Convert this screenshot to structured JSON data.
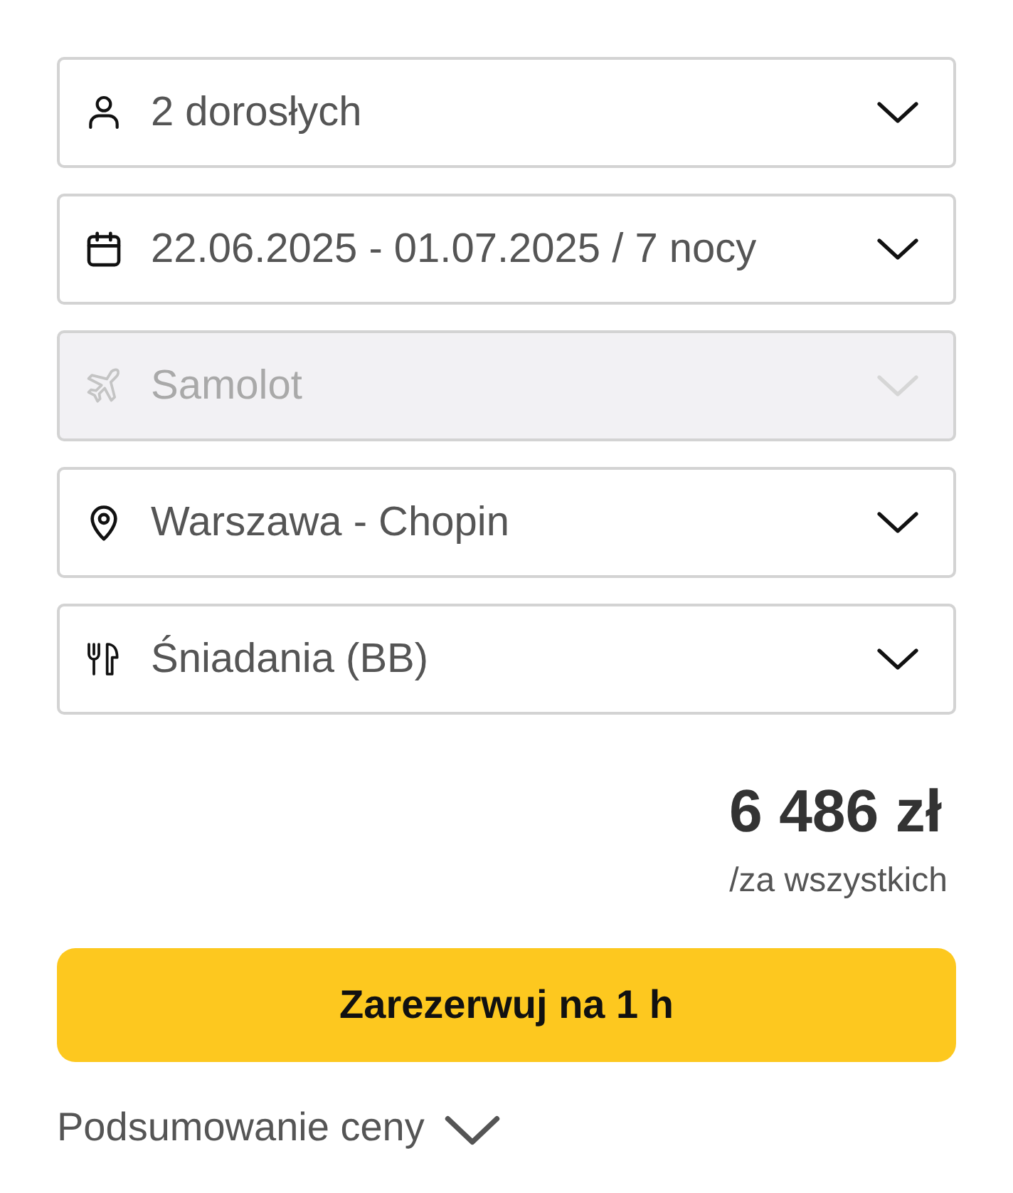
{
  "fields": [
    {
      "kind": "guests",
      "value": "2 dorosłych",
      "disabled": false
    },
    {
      "kind": "dates",
      "value": "22.06.2025 - 01.07.2025 / 7 nocy",
      "disabled": false
    },
    {
      "kind": "transport",
      "value": "Samolot",
      "disabled": true
    },
    {
      "kind": "departure",
      "value": "Warszawa - Chopin",
      "disabled": false
    },
    {
      "kind": "board",
      "value": "Śniadania (BB)",
      "disabled": false
    }
  ],
  "price": {
    "amount": "6 486 zł",
    "note": "/za wszystkich"
  },
  "book_button": {
    "label": "Zarezerwuj na 1 h"
  },
  "summary_toggle": {
    "label": "Podsumowanie ceny",
    "expanded": false
  }
}
